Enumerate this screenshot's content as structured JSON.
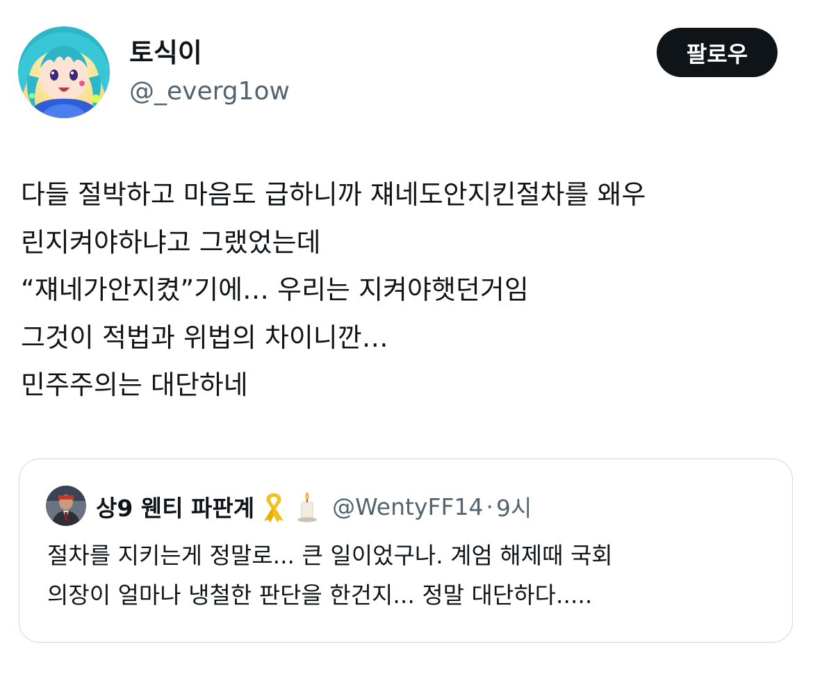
{
  "author": {
    "display_name": "토식이",
    "handle": "@_everg1ow",
    "avatar_icon": "anime-character-avatar"
  },
  "follow_button": {
    "label": "팔로우"
  },
  "tweet": {
    "lines": [
      "다들 절박하고 마음도 급하니까 쟤네도안지킨절차를 왜우",
      "린지켜야하냐고 그랬었는데",
      "“쟤네가안지켰”기에… 우리는 지켜야햇던거임",
      "그것이 적법과 위법의 차이니깐…",
      "민주주의는 대단하네"
    ]
  },
  "quote": {
    "display_name": "상9 웬티 파판계",
    "emoji_icons": [
      "yellow-ribbon-icon",
      "candle-icon"
    ],
    "handle": "@WentyFF14",
    "separator": "·",
    "time": "9시",
    "avatar_icon": "person-avatar",
    "lines": [
      "절차를 지키는게 정말로... 큰 일이었구나. 계엄 해제때 국회",
      "의장이 얼마나 냉철한 판단을 한건지... 정말 대단하다....."
    ]
  },
  "colors": {
    "text_primary": "#0f1419",
    "text_secondary": "#536471",
    "button_bg": "#0f1419",
    "button_text": "#ffffff",
    "card_border": "#cfd9de"
  }
}
